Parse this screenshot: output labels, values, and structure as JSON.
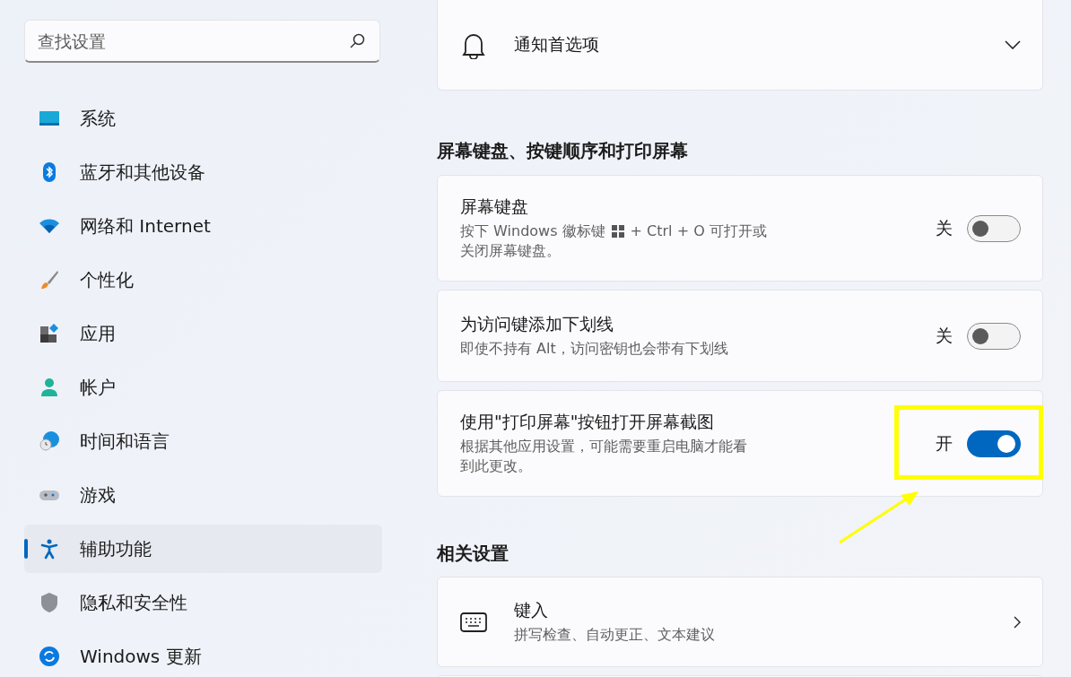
{
  "search": {
    "placeholder": "查找设置"
  },
  "nav": [
    {
      "label": "系统",
      "kind": "system",
      "selected": false
    },
    {
      "label": "蓝牙和其他设备",
      "kind": "bluetooth",
      "selected": false
    },
    {
      "label": "网络和 Internet",
      "kind": "wifi",
      "selected": false
    },
    {
      "label": "个性化",
      "kind": "brush",
      "selected": false
    },
    {
      "label": "应用",
      "kind": "apps",
      "selected": false
    },
    {
      "label": "帐户",
      "kind": "person",
      "selected": false
    },
    {
      "label": "时间和语言",
      "kind": "globe",
      "selected": false
    },
    {
      "label": "游戏",
      "kind": "gamepad",
      "selected": false
    },
    {
      "label": "辅助功能",
      "kind": "accessibility",
      "selected": true
    },
    {
      "label": "隐私和安全性",
      "kind": "shield",
      "selected": false
    },
    {
      "label": "Windows 更新",
      "kind": "update",
      "selected": false
    }
  ],
  "sections": [
    {
      "cards": [
        {
          "kind": "expander",
          "title": "通知首选项"
        }
      ]
    },
    {
      "heading": "屏幕键盘、按键顺序和打印屏幕",
      "cards": [
        {
          "kind": "toggle",
          "title": "屏幕键盘",
          "description": [
            [
              "按下 Windows 徽标键",
              "+ Ctrl + O 可打开或"
            ],
            [
              "关闭屏幕键盘。"
            ]
          ],
          "state_label": "关",
          "on": false,
          "highlighted": false
        },
        {
          "kind": "toggle",
          "title": "为访问键添加下划线",
          "description": [
            [
              "即使不持有 Alt，访问密钥也会带有下划线"
            ]
          ],
          "state_label": "关",
          "on": false,
          "highlighted": false
        },
        {
          "kind": "toggle",
          "title": "使用\"打印屏幕\"按钮打开屏幕截图",
          "description": [
            [
              "根据其他应用设置，可能需要重启电脑才能看"
            ],
            [
              "到此更改。"
            ]
          ],
          "state_label": "开",
          "on": true,
          "highlighted": true
        }
      ]
    },
    {
      "heading": "相关设置",
      "cards": [
        {
          "kind": "link",
          "title": "键入",
          "description": [
            [
              "拼写检查、自动更正、文本建议"
            ]
          ]
        },
        {
          "kind": "partial"
        }
      ]
    }
  ]
}
